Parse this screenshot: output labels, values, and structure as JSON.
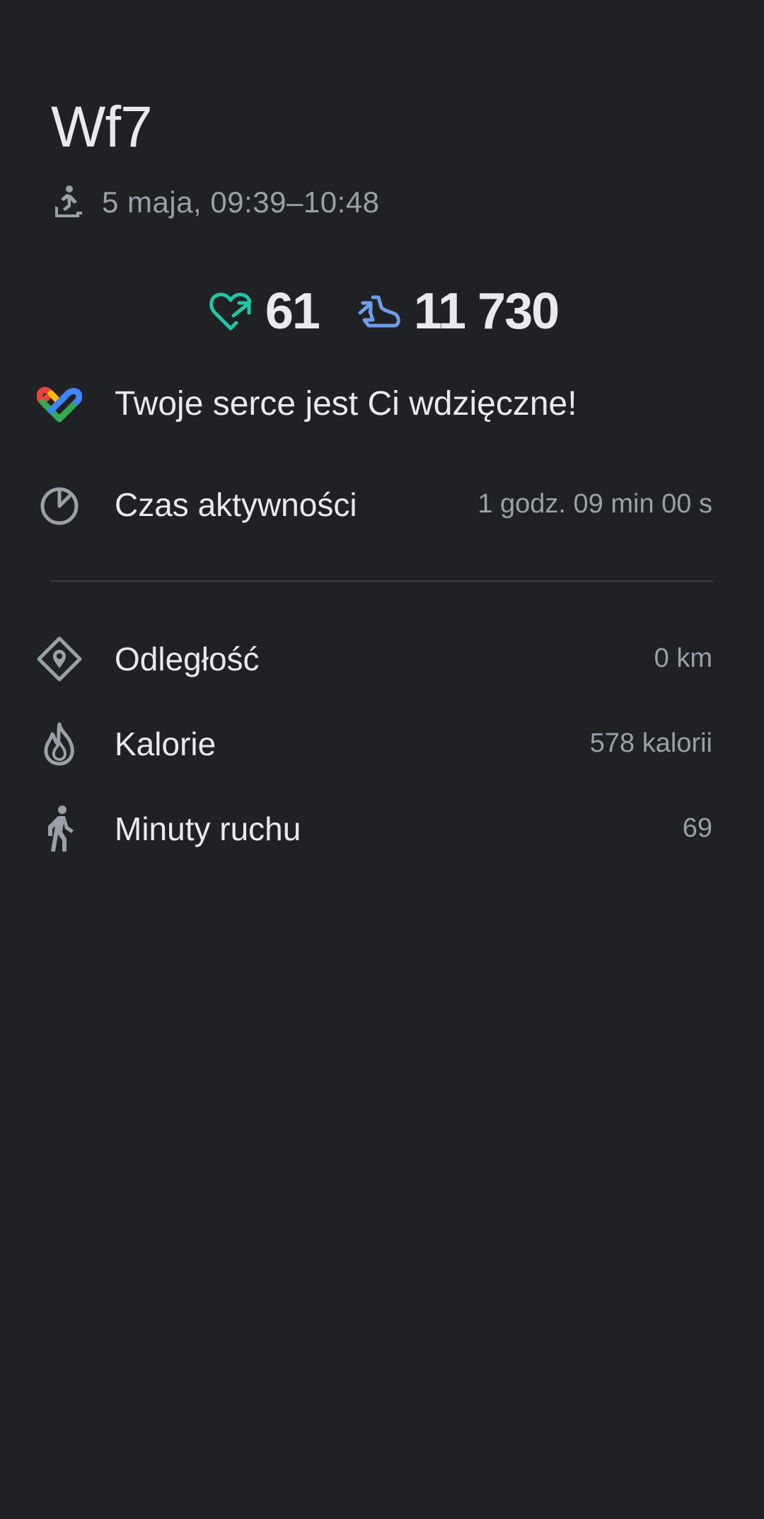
{
  "activity": {
    "title": "Wf7",
    "date_time": "5 maja, 09:39–10:48",
    "type_icon": "treadmill-icon"
  },
  "summary": {
    "heart_points": "61",
    "steps": "11 730",
    "heart_color": "#1ec8a5",
    "steps_color": "#6d9eeb"
  },
  "message": {
    "text": "Twoje serce jest Ci wdzięczne!",
    "icon": "google-fit-logo"
  },
  "stats": {
    "active_time": {
      "label": "Czas aktywności",
      "value": "1 godz. 09 min 00 s",
      "icon": "timer-icon"
    },
    "distance": {
      "label": "Odległość",
      "value": "0 km",
      "icon": "location-diamond-icon"
    },
    "calories": {
      "label": "Kalorie",
      "value": "578 kalorii",
      "icon": "flame-icon"
    },
    "move_minutes": {
      "label": "Minuty ruchu",
      "value": "69",
      "icon": "walking-icon"
    }
  }
}
